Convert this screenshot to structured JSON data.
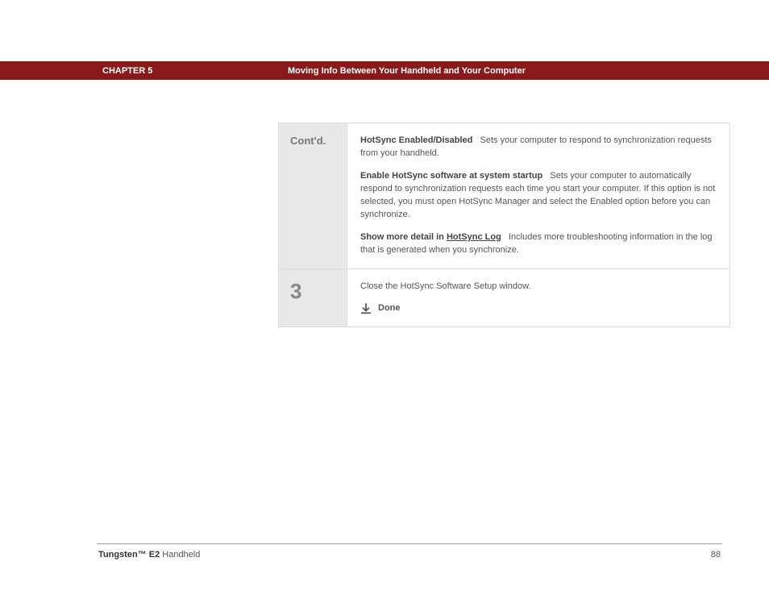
{
  "header": {
    "chapter": "CHAPTER 5",
    "title": "Moving Info Between Your Handheld and Your Computer"
  },
  "rows": {
    "r1": {
      "label": "Cont'd.",
      "opt1_title": "HotSync Enabled/Disabled",
      "opt1_text": "Sets your computer to respond to synchronization requests from your handheld.",
      "opt2_title": "Enable HotSync software at system startup",
      "opt2_text": "Sets your computer to automatically respond to synchronization requests each time you start your computer. If this option is not selected, you must open HotSync Manager and select the Enabled option before you can synchronize.",
      "opt3_title_a": "Show more detail in ",
      "opt3_link": "HotSync Log",
      "opt3_text": "Includes more troubleshooting information in the log that is generated when you synchronize."
    },
    "r2": {
      "num": "3",
      "text": "Close the HotSync Software Setup window.",
      "done": "Done"
    }
  },
  "footer": {
    "brand": "Tungsten™ E2",
    "suffix": " Handheld",
    "page": "88"
  }
}
